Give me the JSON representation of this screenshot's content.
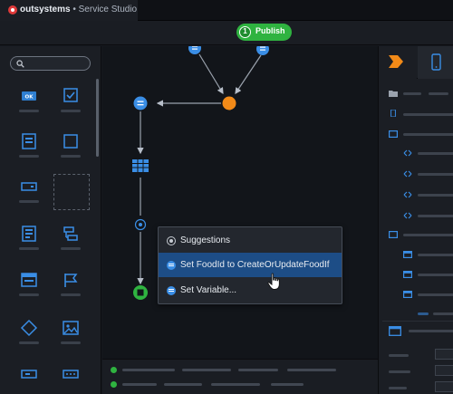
{
  "app": {
    "brand": "outsystems",
    "separator": " • ",
    "product": "Service Studio"
  },
  "toolbar": {
    "publish_count": "1",
    "publish_label": "Publish",
    "accent": "#2fb340"
  },
  "popup": {
    "items": [
      {
        "label": "Suggestions",
        "icon": "suggestions-icon"
      },
      {
        "label": "Set FoodId to CreateOrUpdateFoodIf",
        "icon": "assign-icon",
        "highlighted": true
      },
      {
        "label": "Set Variable...",
        "icon": "assign-icon"
      }
    ]
  },
  "colors": {
    "node_blue": "#3a8ee6",
    "node_orange": "#f28a18",
    "end_green": "#2fb340",
    "highlight": "#1d4d86"
  }
}
